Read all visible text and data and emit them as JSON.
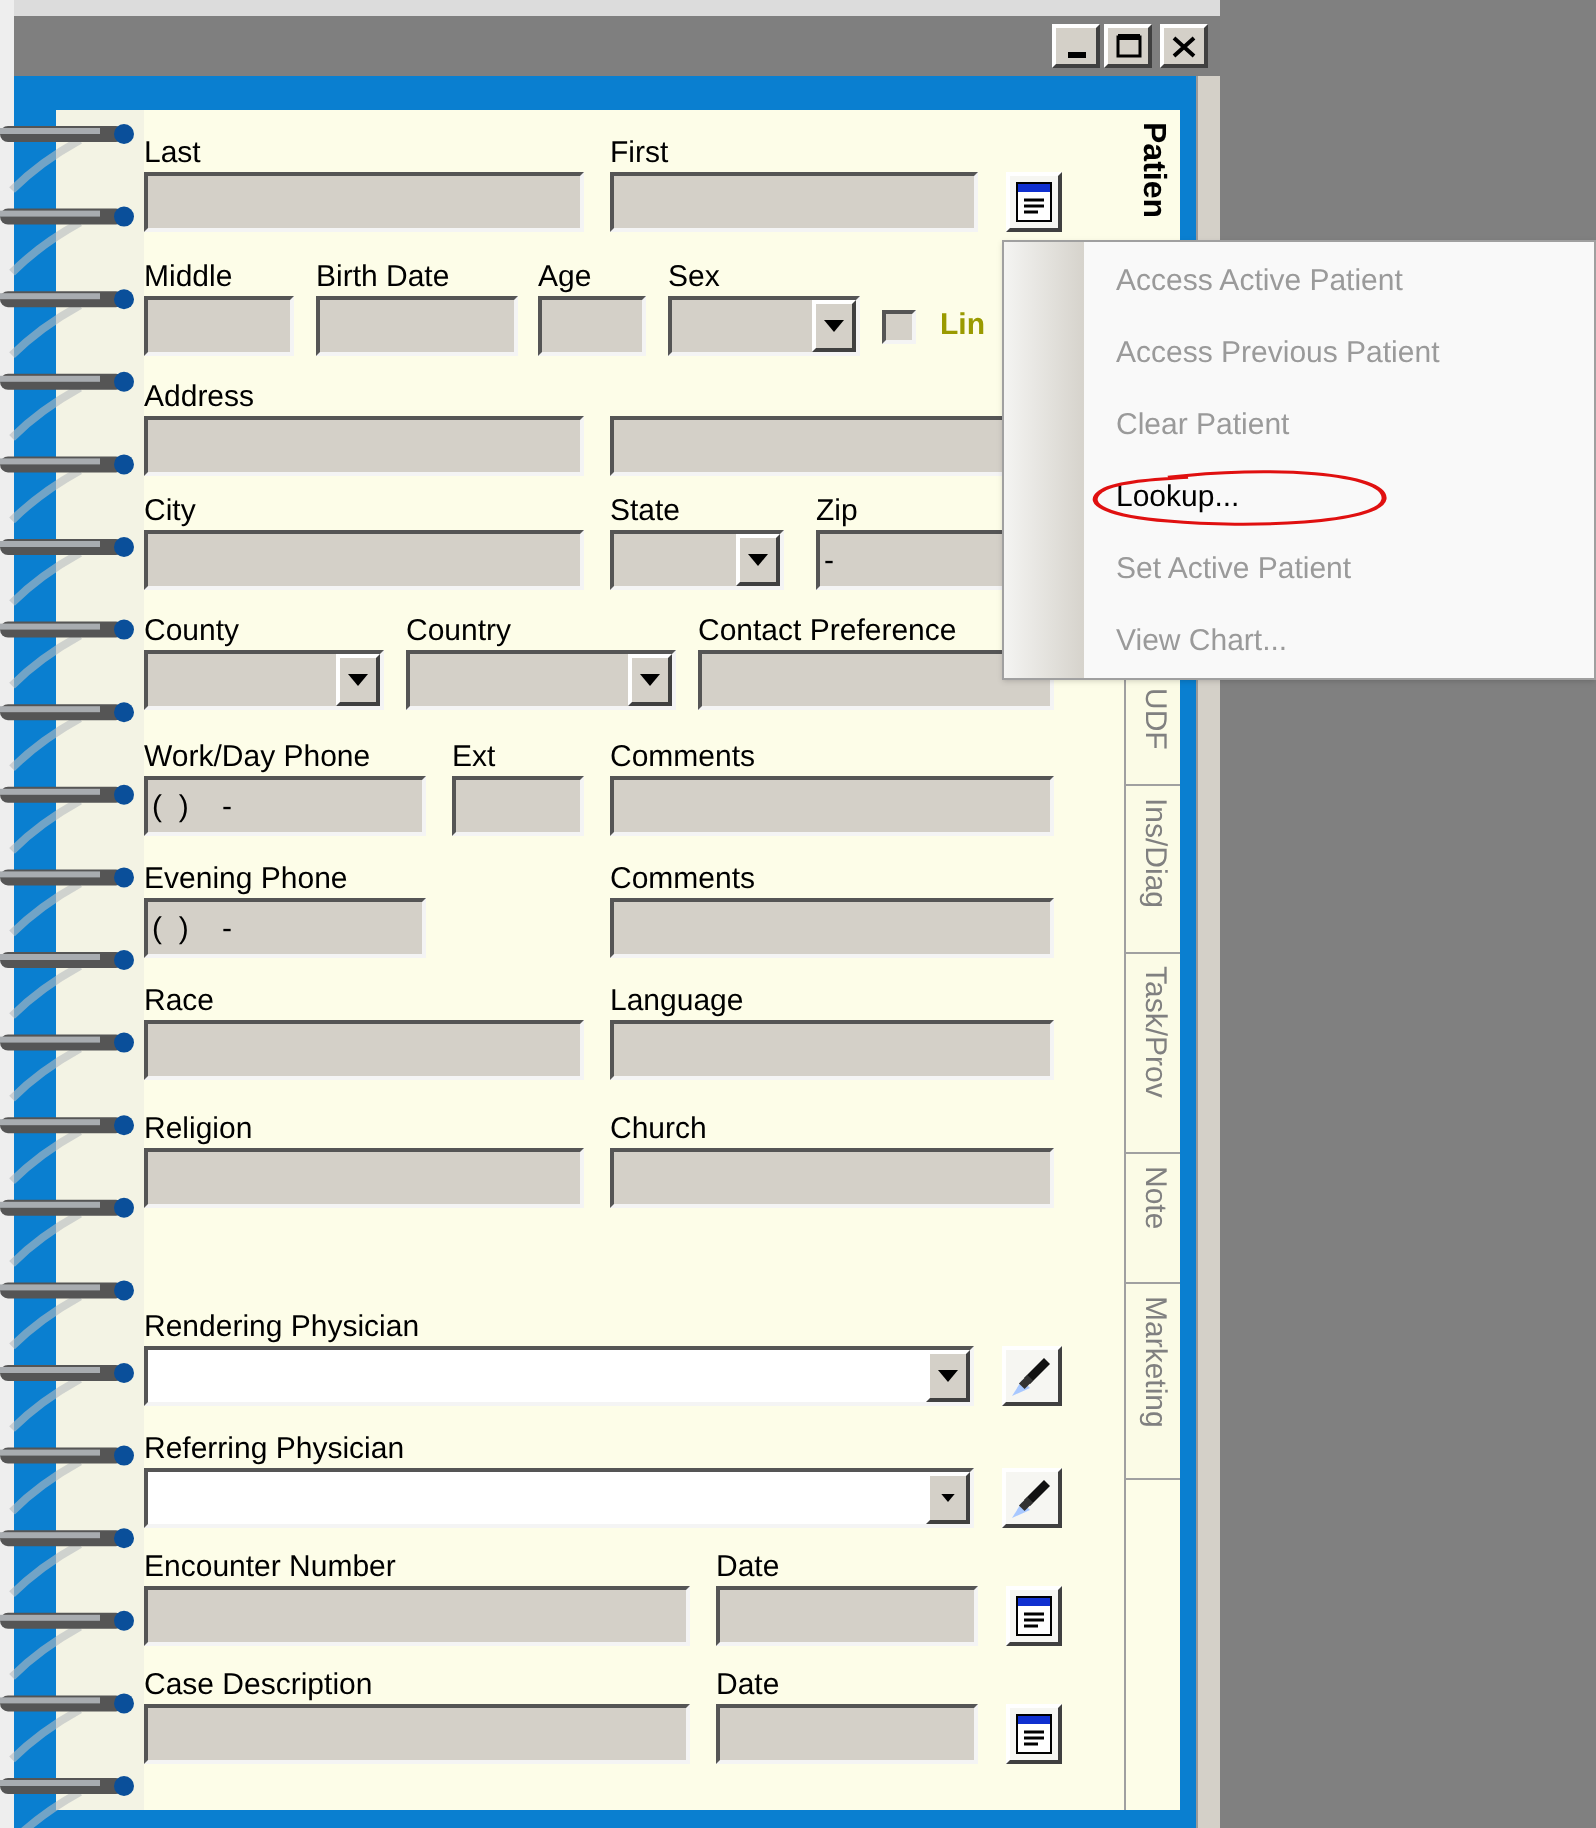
{
  "form": {
    "rows": [
      {
        "fields": [
          {
            "kind": "text",
            "label": "Last"
          },
          {
            "kind": "text",
            "label": "First"
          },
          {
            "kind": "list-button"
          }
        ]
      },
      {
        "fields": [
          {
            "kind": "text",
            "label": "Middle"
          },
          {
            "kind": "text",
            "label": "Birth Date"
          },
          {
            "kind": "text",
            "label": "Age"
          },
          {
            "kind": "dropdown",
            "label": "Sex"
          },
          {
            "kind": "checkbox",
            "label": "Lin",
            "checked": false
          }
        ]
      },
      {
        "fields": [
          {
            "kind": "text",
            "label": "Address"
          },
          {
            "kind": "text"
          }
        ]
      },
      {
        "fields": [
          {
            "kind": "text",
            "label": "City"
          },
          {
            "kind": "dropdown",
            "label": "State"
          },
          {
            "kind": "text",
            "label": "Zip",
            "value": "-"
          }
        ]
      },
      {
        "fields": [
          {
            "kind": "dropdown",
            "label": "County"
          },
          {
            "kind": "dropdown",
            "label": "Country"
          },
          {
            "kind": "text",
            "label": "Contact Preference"
          }
        ]
      },
      {
        "fields": [
          {
            "kind": "text",
            "label": "Work/Day Phone",
            "value": "(  )    -"
          },
          {
            "kind": "text",
            "label": "Ext"
          },
          {
            "kind": "text",
            "label": "Comments"
          }
        ]
      },
      {
        "fields": [
          {
            "kind": "text",
            "label": "Evening Phone",
            "value": "(  )    -"
          },
          {
            "kind": "text",
            "label": "Comments"
          }
        ]
      },
      {
        "fields": [
          {
            "kind": "text",
            "label": "Race"
          },
          {
            "kind": "text",
            "label": "Language"
          }
        ]
      },
      {
        "fields": [
          {
            "kind": "text",
            "label": "Religion"
          },
          {
            "kind": "text",
            "label": "Church"
          }
        ]
      },
      {
        "fields": [
          {
            "kind": "combo",
            "label": "Rendering Physician"
          },
          {
            "kind": "search-button"
          }
        ]
      },
      {
        "fields": [
          {
            "kind": "combo",
            "label": "Referring Physician"
          },
          {
            "kind": "search-button"
          }
        ]
      },
      {
        "fields": [
          {
            "kind": "text",
            "label": "Encounter Number"
          },
          {
            "kind": "text",
            "label": "Date"
          },
          {
            "kind": "list-button"
          }
        ]
      },
      {
        "fields": [
          {
            "kind": "text",
            "label": "Case Description"
          },
          {
            "kind": "text",
            "label": "Date"
          },
          {
            "kind": "list-button"
          }
        ]
      }
    ]
  },
  "tabs": [
    {
      "label": "Patien",
      "selected": true
    },
    {
      "label": "UDF",
      "selected": false
    },
    {
      "label": "Ins/Diag",
      "selected": false
    },
    {
      "label": "Task/Prov",
      "selected": false
    },
    {
      "label": "Note",
      "selected": false
    },
    {
      "label": "Marketing",
      "selected": false
    }
  ],
  "context_menu": {
    "items": [
      {
        "label": "Access Active Patient",
        "disabled": true,
        "circled": false
      },
      {
        "label": "Access Previous Patient",
        "disabled": true,
        "circled": false
      },
      {
        "label": "Clear Patient",
        "disabled": true,
        "circled": false
      },
      {
        "label": "Lookup...",
        "disabled": false,
        "circled": true
      },
      {
        "label": "Set Active Patient",
        "disabled": true,
        "circled": false
      },
      {
        "label": "View Chart...",
        "disabled": true,
        "circled": false
      }
    ]
  }
}
